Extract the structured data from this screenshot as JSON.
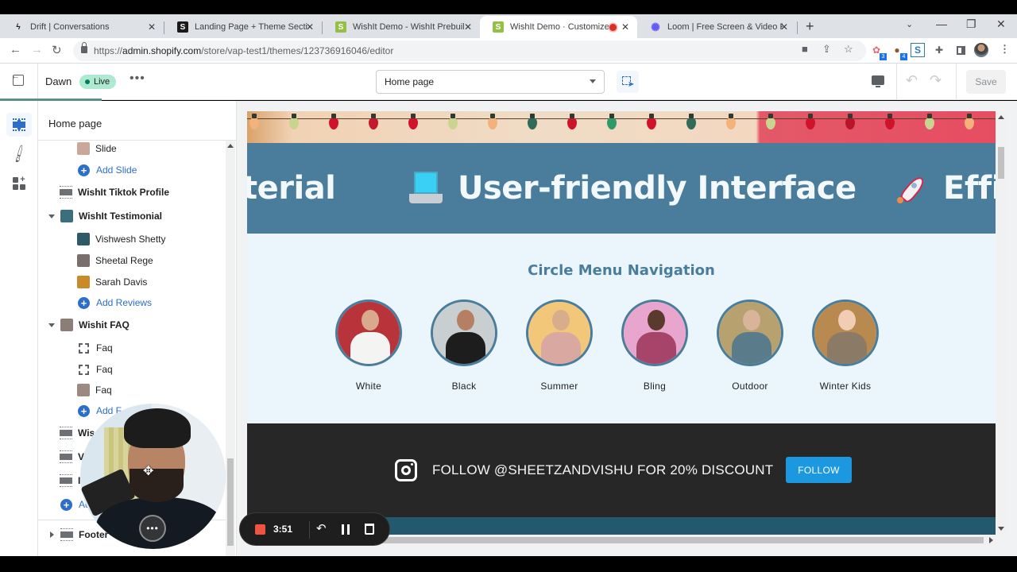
{
  "browser": {
    "tabs": [
      {
        "title": "Drift | Conversations",
        "icon": "drift-bolt-icon",
        "active": false
      },
      {
        "title": "Landing Page + Theme Sections",
        "icon": "shopify-bag-icon",
        "active": false
      },
      {
        "title": "WishIt Demo - WishIt Prebuilt Th",
        "icon": "shopify-bag-icon",
        "active": false
      },
      {
        "title": "WishIt Demo · Customize Da",
        "icon": "shopify-bag-icon",
        "active": true,
        "recording": true
      },
      {
        "title": "Loom | Free Screen & Video Reco",
        "icon": "loom-icon",
        "active": false
      }
    ],
    "new_tab_label": "+",
    "url_prefix": "https://",
    "url_host": "admin.shopify.com",
    "url_path": "/store/vap-test1/themes/123736916046/editor",
    "extensions": [
      {
        "name": "extension-1",
        "badge": "3"
      },
      {
        "name": "extension-cookie",
        "badge": "4"
      },
      {
        "name": "extension-s",
        "badge": ""
      }
    ]
  },
  "editor": {
    "theme_name": "Dawn",
    "live_label": "Live",
    "page_select_value": "Home page",
    "save_label": "Save"
  },
  "sidebar": {
    "title": "Home page",
    "items": [
      {
        "type": "block",
        "label": "Slide",
        "indent": 2,
        "thumb": "#c9a89a"
      },
      {
        "type": "add",
        "label": "Add Slide",
        "indent": 2
      },
      {
        "type": "section",
        "label": "WishIt Tiktok Profile",
        "indent": 1
      },
      {
        "type": "section-open",
        "label": "WishIt Testimonial",
        "indent": 1,
        "thumb": "#3b6f7d"
      },
      {
        "type": "block",
        "label": "Vishwesh Shetty",
        "indent": 2,
        "thumb": "#2e5968"
      },
      {
        "type": "block",
        "label": "Sheetal Rege",
        "indent": 2,
        "thumb": "#7a6f6a"
      },
      {
        "type": "block",
        "label": "Sarah Davis",
        "indent": 2,
        "thumb": "#c98a2a"
      },
      {
        "type": "add",
        "label": "Add Reviews",
        "indent": 2
      },
      {
        "type": "section-open",
        "label": "Wishit FAQ",
        "indent": 1,
        "thumb": "#8c7d76"
      },
      {
        "type": "faq",
        "label": "Faq",
        "indent": 2
      },
      {
        "type": "faq",
        "label": "Faq",
        "indent": 2
      },
      {
        "type": "block",
        "label": "Faq",
        "indent": 2,
        "thumb": "#9c8a80"
      },
      {
        "type": "add",
        "label": "Add F",
        "indent": 2
      },
      {
        "type": "section",
        "label": "Wis",
        "indent": 1
      },
      {
        "type": "section",
        "label": "V",
        "indent": 1
      },
      {
        "type": "section",
        "label": "I",
        "indent": 1
      },
      {
        "type": "add",
        "label": "Ad",
        "indent": 1
      }
    ],
    "footer_label": "Footer"
  },
  "preview": {
    "marquee": [
      {
        "text": "terial"
      },
      {
        "text": "User-friendly Interface",
        "icon": "laptop-icon"
      },
      {
        "text": "Effi",
        "icon": "rocket-icon"
      }
    ],
    "circle_menu": {
      "title": "Circle Menu Navigation",
      "items": [
        {
          "label": "White",
          "bg": "#b8343a",
          "skin": "#d9a98e",
          "top": "#f4f4f2"
        },
        {
          "label": "Black",
          "bg": "#c9cfd1",
          "skin": "#b67f63",
          "top": "#1d1d1d"
        },
        {
          "label": "Summer",
          "bg": "#f2c77a",
          "skin": "#d8ad8c",
          "top": "#d9a8a0"
        },
        {
          "label": "Bling",
          "bg": "#e8a6cf",
          "skin": "#5a3a2c",
          "top": "#a6446a"
        },
        {
          "label": "Outdoor",
          "bg": "#b6a16f",
          "skin": "#d9b39a",
          "top": "#5a7b8a"
        },
        {
          "label": "Winter Kids",
          "bg": "#b88a50",
          "skin": "#f0cdb4",
          "top": "#8a7a66"
        }
      ]
    },
    "follow": {
      "text": "FOLLOW @SHEETZANDVISHU FOR 20% DISCOUNT",
      "button_label": "FOLLOW"
    }
  },
  "loom": {
    "elapsed": "3:51"
  },
  "colors": {
    "accent_blue": "#2c6ecb",
    "marquee_bg": "#4a7d9b",
    "follow_bg": "#272727",
    "follow_button": "#1b98e0",
    "live_badge": "#aee9d1",
    "loom_stop": "#f0533f"
  }
}
